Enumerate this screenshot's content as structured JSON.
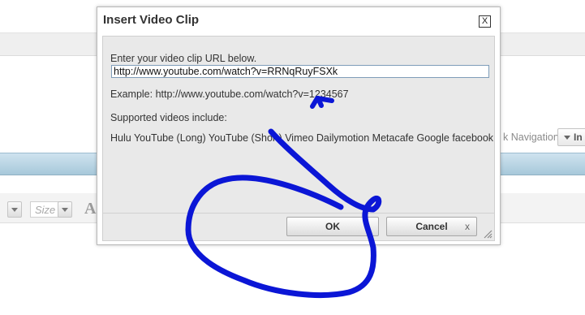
{
  "background": {
    "navigation_label": "k Navigation",
    "navigation_button": "In",
    "size_placeholder": "Size",
    "font_glyph": "A"
  },
  "dialog": {
    "title": "Insert Video Clip",
    "close_label": "X",
    "prompt": "Enter your video clip URL below.",
    "url_value": "http://www.youtube.com/watch?v=RRNqRuyFSXk",
    "example": "Example: http://www.youtube.com/watch?v=1234567",
    "supported_heading": "Supported videos include:",
    "supported_list": "Hulu YouTube (Long) YouTube (Short) Vimeo Dailymotion Metacafe Google facebook",
    "ok_label": "OK",
    "cancel_label": "Cancel",
    "cancel_icon": "x"
  },
  "colors": {
    "annotation": "#0b16d6",
    "header_blue": "#a7c8da"
  }
}
